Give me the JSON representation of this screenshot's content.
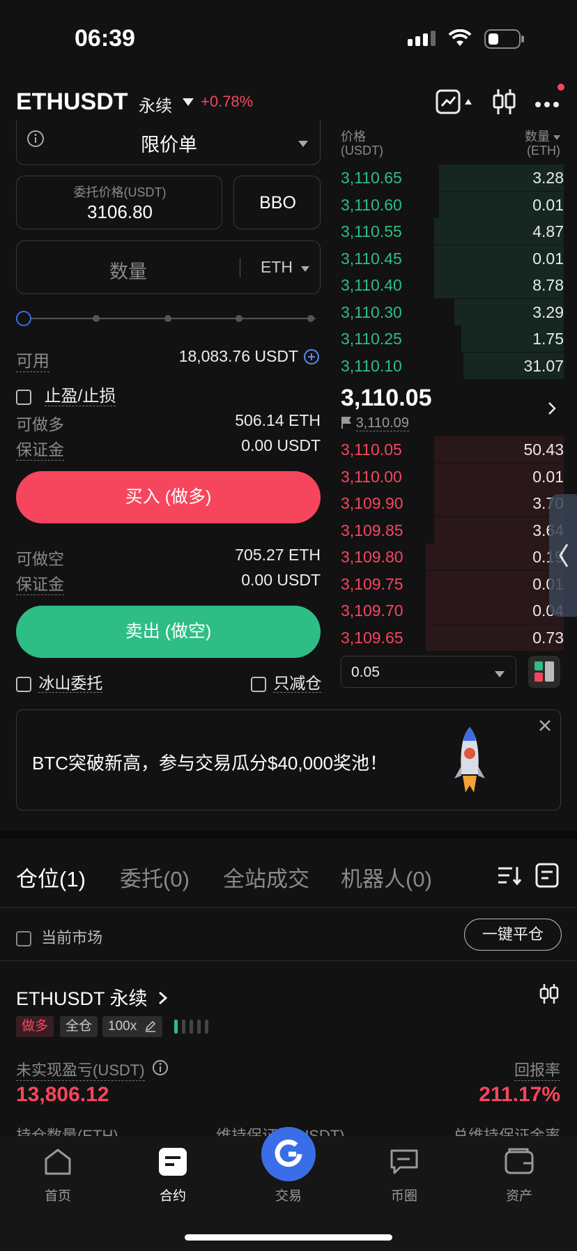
{
  "status_bar": {
    "time": "06:39"
  },
  "header": {
    "symbol": "ETHUSDT",
    "type": "永续",
    "change": "+0.78%"
  },
  "order_form": {
    "order_type": "限价单",
    "price_label": "委托价格(USDT)",
    "price_value": "3106.80",
    "bbo_label": "BBO",
    "qty_placeholder": "数量",
    "qty_unit": "ETH",
    "available_label": "可用",
    "available_value": "18,083.76 USDT",
    "tpsl_label": "止盈/止损",
    "long": {
      "can_label": "可做多",
      "can_value": "506.14 ETH",
      "margin_label": "保证金",
      "margin_value": "0.00 USDT"
    },
    "buy_button": "买入 (做多)",
    "short": {
      "can_label": "可做空",
      "can_value": "705.27 ETH",
      "margin_label": "保证金",
      "margin_value": "0.00 USDT"
    },
    "sell_button": "卖出 (做空)",
    "iceberg_label": "冰山委托",
    "reduce_only_label": "只减仓"
  },
  "orderbook": {
    "price_header": "价格",
    "price_unit": "(USDT)",
    "qty_header": "数量",
    "qty_unit": "(ETH)",
    "asks": [
      {
        "price": "3,110.65",
        "qty": "3.28",
        "depth": 0.56
      },
      {
        "price": "3,110.60",
        "qty": "0.01",
        "depth": 0.56
      },
      {
        "price": "3,110.55",
        "qty": "4.87",
        "depth": 0.58
      },
      {
        "price": "3,110.45",
        "qty": "0.01",
        "depth": 0.58
      },
      {
        "price": "3,110.40",
        "qty": "8.78",
        "depth": 0.58
      },
      {
        "price": "3,110.30",
        "qty": "3.29",
        "depth": 0.49
      },
      {
        "price": "3,110.25",
        "qty": "1.75",
        "depth": 0.46
      },
      {
        "price": "3,110.10",
        "qty": "31.07",
        "depth": 0.45
      }
    ],
    "last_price": "3,110.05",
    "mark_price": "3,110.09",
    "bids": [
      {
        "price": "3,110.05",
        "qty": "50.43",
        "depth": 0.58
      },
      {
        "price": "3,110.00",
        "qty": "0.01",
        "depth": 0.58
      },
      {
        "price": "3,109.90",
        "qty": "3.70",
        "depth": 0.58
      },
      {
        "price": "3,109.85",
        "qty": "3.64",
        "depth": 0.58
      },
      {
        "price": "3,109.80",
        "qty": "0.19",
        "depth": 0.62
      },
      {
        "price": "3,109.75",
        "qty": "0.01",
        "depth": 0.62
      },
      {
        "price": "3,109.70",
        "qty": "0.04",
        "depth": 0.62
      },
      {
        "price": "3,109.65",
        "qty": "0.73",
        "depth": 0.62
      }
    ],
    "precision": "0.05"
  },
  "banner": {
    "text": "BTC突破新高，参与交易瓜分$40,000奖池！"
  },
  "tabs": [
    "仓位(1)",
    "委托(0)",
    "全站成交",
    "机器人(0)"
  ],
  "filter": {
    "current_market": "当前市场",
    "close_all": "一键平仓"
  },
  "position": {
    "symbol": "ETHUSDT 永续",
    "side": "做多",
    "margin_mode": "全仓",
    "leverage": "100x",
    "pnl_label": "未实现盈亏(USDT)",
    "pnl_value": "13,806.12",
    "roe_label": "回报率",
    "roe_value": "211.17%",
    "qty_label": "持仓数量(ETH)",
    "maint_label": "维持保证金(USDT)",
    "maint_rate_label": "总维持保证金率"
  },
  "bottom_nav": [
    "首页",
    "合约",
    "交易",
    "币圈",
    "资产"
  ],
  "colors": {
    "green": "#2ebd85",
    "red": "#f6465d",
    "accent": "#3a6ee8"
  }
}
